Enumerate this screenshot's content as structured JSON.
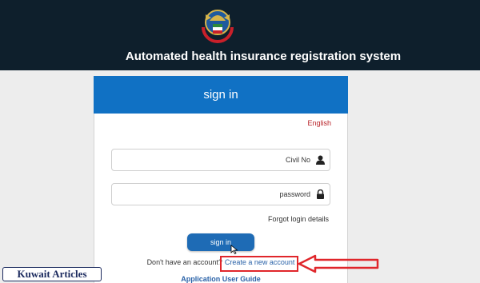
{
  "header": {
    "title": "Automated health insurance registration system",
    "emblem": "state-emblem-icon"
  },
  "card": {
    "title": "sign in",
    "language_link": "English",
    "civil_no_placeholder": "Civil No",
    "civil_icon": "user-icon",
    "password_placeholder": "password",
    "password_icon": "lock-icon",
    "forgot_link": "Forgot login details",
    "signin_button": "sign in",
    "no_account_text": "Don't have an account?",
    "create_account_link": "Create a new account",
    "guide_link": "Application User Guide"
  },
  "watermark": "Kuwait Articles",
  "colors": {
    "header_bg": "#0e1f2c",
    "card_header_bg": "#1071c4",
    "button_bg": "#1e6bb5",
    "link": "#2a62a8",
    "language_link": "#b82328",
    "annotation_red": "#e0262b"
  }
}
